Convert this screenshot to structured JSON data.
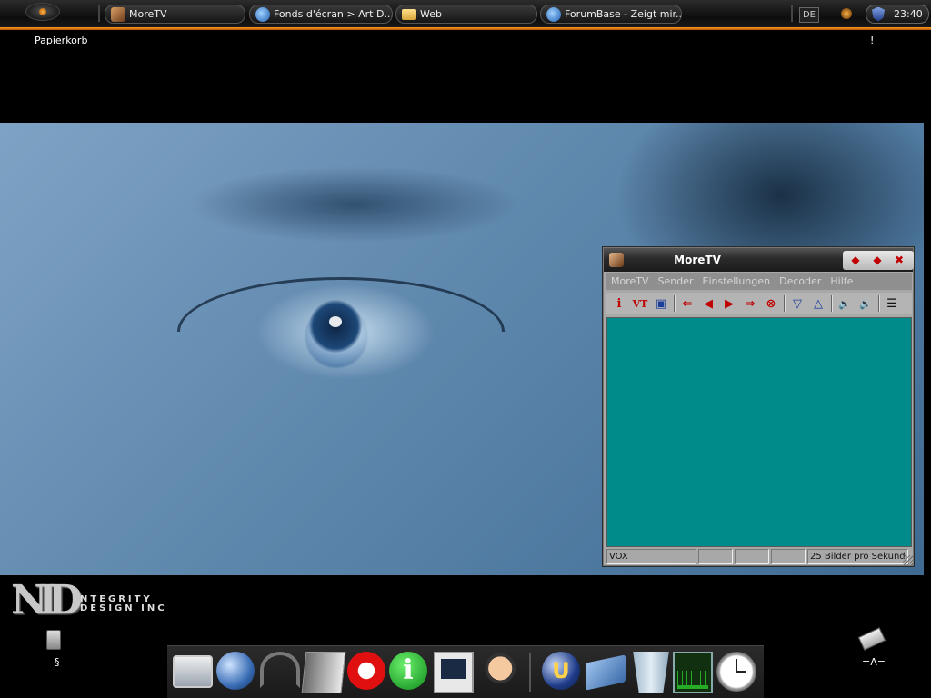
{
  "taskbar": {
    "tasks": [
      {
        "label": "MoreTV",
        "icon": "moretv-icon"
      },
      {
        "label": "Fonds d'écran > Art D...",
        "icon": "internet-explorer-icon"
      },
      {
        "label": "Web",
        "icon": "folder-icon"
      },
      {
        "label": "ForumBase - Zeigt mir...",
        "icon": "internet-explorer-icon"
      }
    ],
    "language": "DE",
    "clock": "23:40"
  },
  "desktop": {
    "recycle_bin_label": "Papierkorb",
    "top_right_label": "!",
    "usb_label": "§",
    "chip_label": "=A="
  },
  "logo": {
    "mark": "NID",
    "text_line1": "NTEGRITY",
    "text_line2": "DESIGN INC"
  },
  "moretv": {
    "title": "MoreTV",
    "controls": [
      "◆",
      "◆",
      "✖"
    ],
    "menu": [
      "MoreTV",
      "Sender",
      "Einstellungen",
      "Decoder",
      "Hilfe"
    ],
    "toolbar": [
      {
        "name": "info",
        "glyph": "i"
      },
      {
        "name": "videotext",
        "glyph": "VT"
      },
      {
        "name": "epg",
        "glyph": "▣"
      },
      {
        "name": "first-channel",
        "glyph": "⇐"
      },
      {
        "name": "prev-channel",
        "glyph": "◀"
      },
      {
        "name": "next-channel",
        "glyph": "▶"
      },
      {
        "name": "last-channel",
        "glyph": "⇒"
      },
      {
        "name": "record",
        "glyph": "⊗"
      },
      {
        "name": "collapse",
        "glyph": "▽"
      },
      {
        "name": "expand",
        "glyph": "△"
      },
      {
        "name": "volume-down",
        "glyph": "🔈"
      },
      {
        "name": "volume-up",
        "glyph": "🔊"
      },
      {
        "name": "document",
        "glyph": "☰"
      }
    ],
    "status": {
      "channel": "VOX",
      "cell2": "",
      "cell3": "",
      "cell4": "",
      "fps": "25 Bilder pro Sekund"
    },
    "video_color": "#008b8b"
  },
  "dock": {
    "items": [
      "monitor-icon",
      "globe-icon",
      "headset-icon",
      "notebook-icon",
      "no-spam-icon",
      "info-icon",
      "x-server-icon",
      "cartoon-icon",
      "unreal-icon",
      "book-icon",
      "trash-icon",
      "system-monitor-icon",
      "clock-icon"
    ]
  },
  "colors": {
    "taskbar_accent": "#ff9a2a",
    "video_area": "#008b8b",
    "control_red": "#c00000"
  }
}
